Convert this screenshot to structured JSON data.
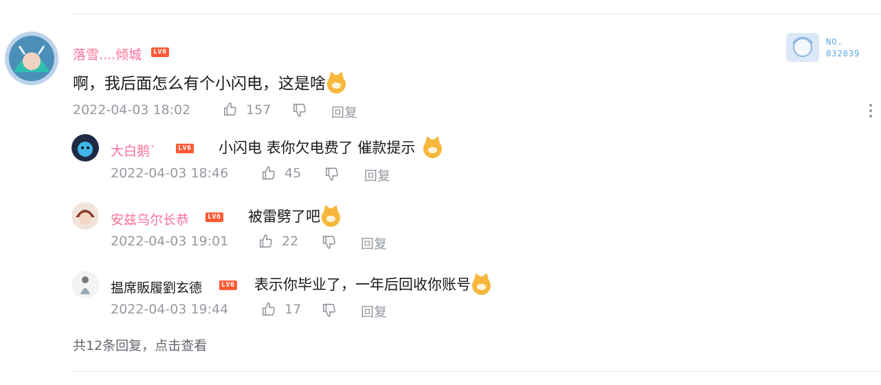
{
  "comment": {
    "username": "落雪....倾城",
    "level": "LV6",
    "text": "啊，我后面怎么有个小闪电，这是啥",
    "time": "2022-04-03 18:02",
    "likes": "157",
    "reply_label": "回复",
    "fan_badge": {
      "line1": "NO.",
      "line2": "032039"
    }
  },
  "replies": [
    {
      "username": "大白鹅`",
      "level": "LV6",
      "text": "小闪电 表你欠电费了 催款提示",
      "time": "2022-04-03 18:46",
      "likes": "45",
      "reply_label": "回复"
    },
    {
      "username": "安兹乌尔长恭",
      "level": "LV6",
      "text": "被雷劈了吧",
      "time": "2022-04-03 19:01",
      "likes": "22",
      "reply_label": "回复"
    },
    {
      "username": "揾席販履劉玄德",
      "level": "LV6",
      "text": "表示你毕业了，一年后回收你账号",
      "time": "2022-04-03 19:44",
      "likes": "17",
      "reply_label": "回复"
    }
  ],
  "footer": {
    "count_text": "共12条回复，",
    "view_link": "点击查看"
  },
  "colors": {
    "username_pink": "#fb7299",
    "level_badge": "#ff5a36",
    "meta_gray": "#9499a0"
  }
}
